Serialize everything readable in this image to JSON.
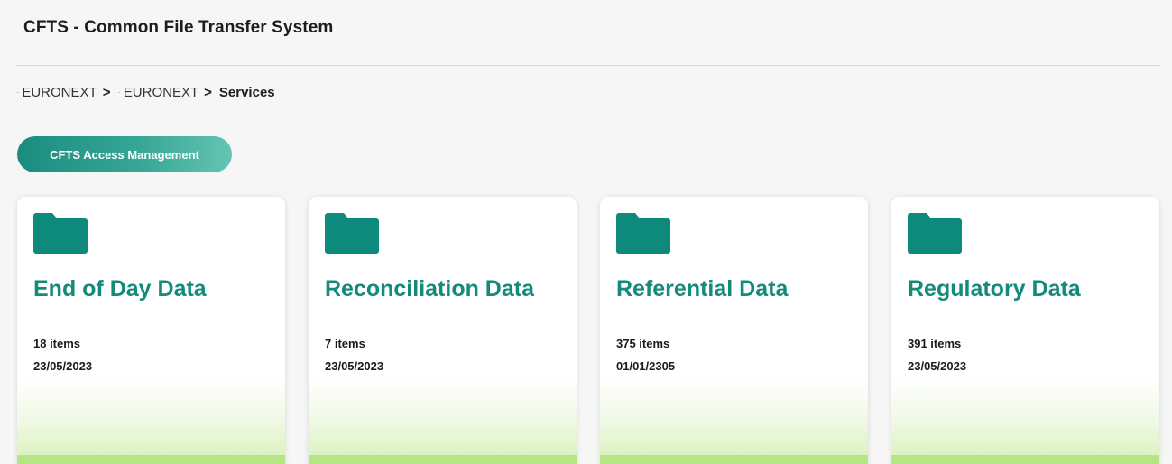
{
  "header": {
    "title": "CFTS - Common File Transfer System"
  },
  "breadcrumb": {
    "items": [
      "EURONEXT",
      "EURONEXT"
    ],
    "separator": ">",
    "current": "Services"
  },
  "actions": {
    "access_management_label": "CFTS Access Management"
  },
  "colors": {
    "accent": "#138a7a",
    "folder": "#0e8a7c",
    "card_bottom": "#b6e684"
  },
  "cards": [
    {
      "title": "End of Day Data",
      "count": "18 items",
      "date": "23/05/2023",
      "icon": "folder-icon"
    },
    {
      "title": "Reconciliation Data",
      "count": "7 items",
      "date": "23/05/2023",
      "icon": "folder-icon"
    },
    {
      "title": "Referential Data",
      "count": "375 items",
      "date": "01/01/2305",
      "icon": "folder-icon"
    },
    {
      "title": "Regulatory Data",
      "count": "391 items",
      "date": "23/05/2023",
      "icon": "folder-icon"
    }
  ]
}
